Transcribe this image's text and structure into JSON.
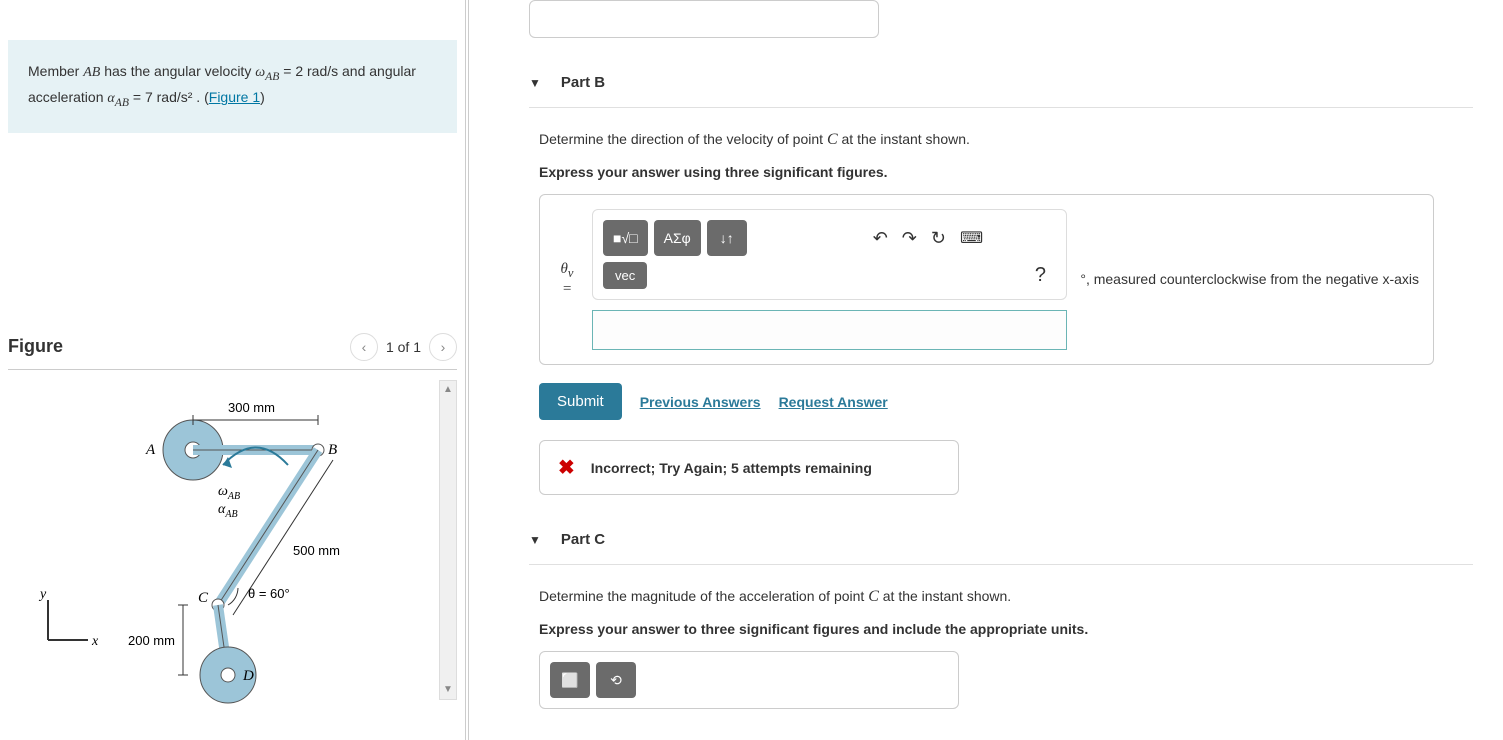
{
  "problem": {
    "member_label": "AB",
    "text_1": "Member ",
    "text_2": " has the angular velocity ",
    "omega_sym": "ω",
    "omega_sub": "AB",
    "omega_val": " = 2  rad/s",
    "text_3": " and angular acceleration ",
    "alpha_sym": "α",
    "alpha_sub": "AB",
    "alpha_val": " = 7  rad/s²",
    "text_4": " . (",
    "figure_link": "Figure 1",
    "text_5": ")"
  },
  "figure": {
    "title": "Figure",
    "pager": "1 of 1",
    "labels": {
      "A": "A",
      "B": "B",
      "C": "C",
      "D": "D",
      "dim_300": "300 mm",
      "dim_500": "500 mm",
      "dim_200": "200 mm",
      "theta": "θ = 60°",
      "omega": "ω",
      "omega_sub": "AB",
      "alpha": "α",
      "alpha_sub": "AB",
      "x": "x",
      "y": "y"
    }
  },
  "partB": {
    "title": "Part B",
    "question": "Determine the direction of the velocity of point ",
    "point": "C",
    "question_2": " at the instant shown.",
    "instruction": "Express your answer using three significant figures.",
    "toolbar": {
      "templates": "■√□",
      "greek": "ΑΣφ",
      "sort": "↓↑",
      "vec": "vec",
      "undo": "↶",
      "redo": "↷",
      "reset": "↻",
      "keyboard": "⌨",
      "help": "?"
    },
    "var_label": "θᵥ =",
    "input_value": "",
    "unit_prefix": "°",
    "unit_text_1": ", measured counterclockwise from the negative ",
    "unit_var": "x",
    "unit_text_2": "-axis",
    "submit": "Submit",
    "prev_answers": "Previous Answers",
    "request_answer": "Request Answer",
    "feedback": "Incorrect; Try Again; 5 attempts remaining"
  },
  "partC": {
    "title": "Part C",
    "question": "Determine the magnitude of the acceleration of point ",
    "point": "C",
    "question_2": " at the instant shown.",
    "instruction": "Express your answer to three significant figures and include the appropriate units."
  }
}
